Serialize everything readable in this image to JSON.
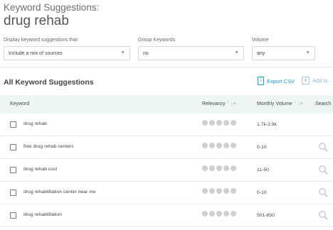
{
  "header": {
    "kicker": "Keyword Suggestions:",
    "title": "drug rehab"
  },
  "filters": {
    "display": {
      "label": "Display keyword suggestions that",
      "value": "Include a mix of sources"
    },
    "group": {
      "label": "Group Keywords",
      "value": "no"
    },
    "volume": {
      "label": "Volume",
      "value": "any"
    }
  },
  "section": {
    "title": "All Keyword Suggestions",
    "export_label": "Export CSV",
    "add_label": "Add to..."
  },
  "table": {
    "columns": {
      "keyword": "Keyword",
      "relevancy": "Relevancy",
      "monthly_volume": "Monthly Volume",
      "search": "Search"
    },
    "rows": [
      {
        "keyword": "drug rehab",
        "relevancy_dots": 5,
        "volume": "1.7k-2.9k",
        "search_icon": false
      },
      {
        "keyword": "free drug rehab centers",
        "relevancy_dots": 5,
        "volume": "0-10",
        "search_icon": true
      },
      {
        "keyword": "drug rehab cost",
        "relevancy_dots": 5,
        "volume": "11-50",
        "search_icon": true
      },
      {
        "keyword": "drug rehabilitation center near me",
        "relevancy_dots": 5,
        "volume": "0-10",
        "search_icon": true
      },
      {
        "keyword": "drug rehabilitation",
        "relevancy_dots": 5,
        "volume": "501-850",
        "search_icon": true
      }
    ]
  },
  "colors": {
    "accent": "#1a9bd6",
    "header_bg": "#eef6f4",
    "dot_gray": "#cfcfcf"
  }
}
